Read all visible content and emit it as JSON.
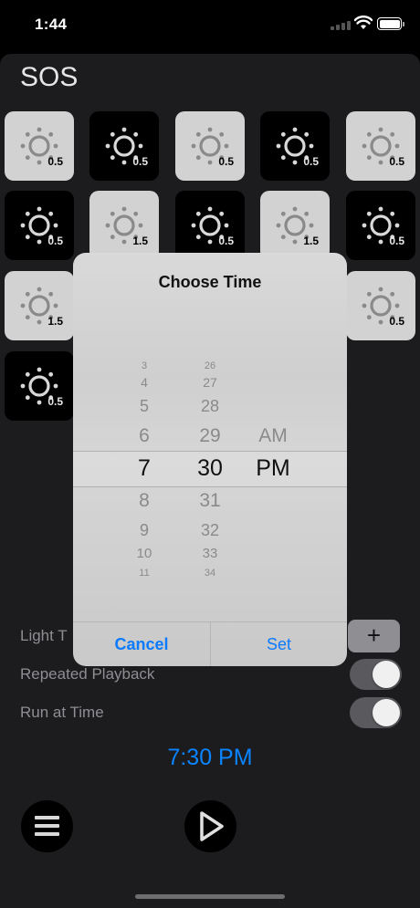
{
  "status": {
    "time": "1:44"
  },
  "title": "SOS",
  "tiles": [
    {
      "value": "0.5",
      "style": "light"
    },
    {
      "value": "0.5",
      "style": "dark"
    },
    {
      "value": "0.5",
      "style": "light"
    },
    {
      "value": "0.5",
      "style": "dark"
    },
    {
      "value": "0.5",
      "style": "light"
    },
    {
      "value": "0.5",
      "style": "dark"
    },
    {
      "value": "1.5",
      "style": "light"
    },
    {
      "value": "0.5",
      "style": "dark"
    },
    {
      "value": "1.5",
      "style": "light"
    },
    {
      "value": "0.5",
      "style": "dark"
    },
    {
      "value": "1.5",
      "style": "light"
    },
    {
      "value": "0.5",
      "style": "light"
    },
    {
      "value": "0.5",
      "style": "dark"
    }
  ],
  "rows": {
    "light_time": "Light T",
    "repeated_playback": "Repeated Playback",
    "run_at_time": "Run at Time"
  },
  "plus_label": "+",
  "scheduled_time": "7:30 PM",
  "dialog": {
    "title": "Choose Time",
    "cancel": "Cancel",
    "set": "Set",
    "hours": [
      "3",
      "4",
      "5",
      "6",
      "7",
      "8",
      "9",
      "10",
      "11"
    ],
    "minutes": [
      "26",
      "27",
      "28",
      "29",
      "30",
      "31",
      "32",
      "33",
      "34"
    ],
    "period": [
      "AM",
      "PM"
    ],
    "selected": {
      "hour": "7",
      "minute": "30",
      "period": "PM"
    }
  },
  "colors": {
    "accent": "#0a84ff",
    "tile_light": "#d2d2d2",
    "tile_dark": "#000000",
    "sheet": "#1c1c1e"
  },
  "icons": {
    "tile": "sun-icon",
    "menu": "hamburger-icon",
    "play": "play-icon"
  }
}
